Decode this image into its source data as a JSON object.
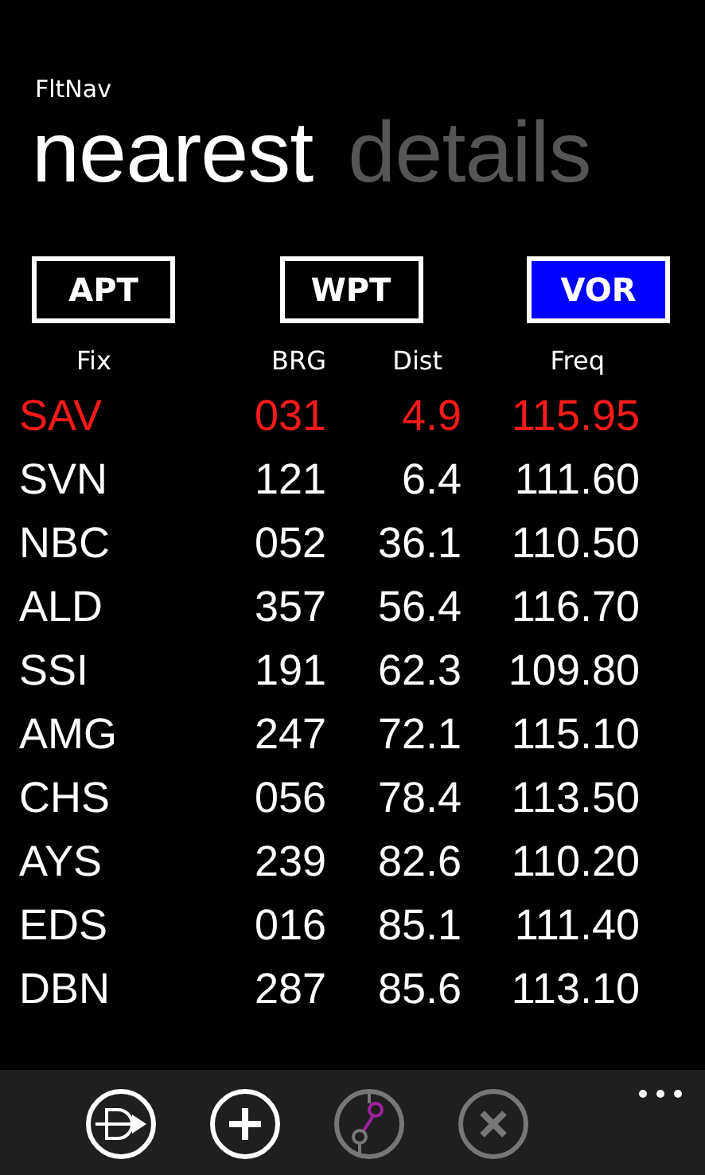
{
  "app_title": "FltNav",
  "pivot": [
    {
      "label": "nearest",
      "selected": true
    },
    {
      "label": "details",
      "selected": false
    }
  ],
  "filters": [
    {
      "label": "APT",
      "selected": false
    },
    {
      "label": "WPT",
      "selected": false
    },
    {
      "label": "VOR",
      "selected": true
    }
  ],
  "table": {
    "columns": [
      "Fix",
      "BRG",
      "Dist",
      "Freq"
    ],
    "rows": [
      {
        "cells": [
          "SAV",
          "031",
          "4.9",
          "115.95"
        ],
        "selected": true
      },
      {
        "cells": [
          "SVN",
          "121",
          "6.4",
          "111.60"
        ],
        "selected": false
      },
      {
        "cells": [
          "NBC",
          "052",
          "36.1",
          "110.50"
        ],
        "selected": false
      },
      {
        "cells": [
          "ALD",
          "357",
          "56.4",
          "116.70"
        ],
        "selected": false
      },
      {
        "cells": [
          "SSI",
          "191",
          "62.3",
          "109.80"
        ],
        "selected": false
      },
      {
        "cells": [
          "AMG",
          "247",
          "72.1",
          "115.10"
        ],
        "selected": false
      },
      {
        "cells": [
          "CHS",
          "056",
          "78.4",
          "113.50"
        ],
        "selected": false
      },
      {
        "cells": [
          "AYS",
          "239",
          "82.6",
          "110.20"
        ],
        "selected": false
      },
      {
        "cells": [
          "EDS",
          "016",
          "85.1",
          "111.40"
        ],
        "selected": false
      },
      {
        "cells": [
          "DBN",
          "287",
          "85.6",
          "113.10"
        ],
        "selected": false
      }
    ]
  },
  "app_bar": {
    "buttons": [
      {
        "kind": "direct",
        "disabled": false
      },
      {
        "kind": "add",
        "disabled": false
      },
      {
        "kind": "route",
        "disabled": true
      },
      {
        "kind": "cancel",
        "disabled": true
      }
    ]
  }
}
